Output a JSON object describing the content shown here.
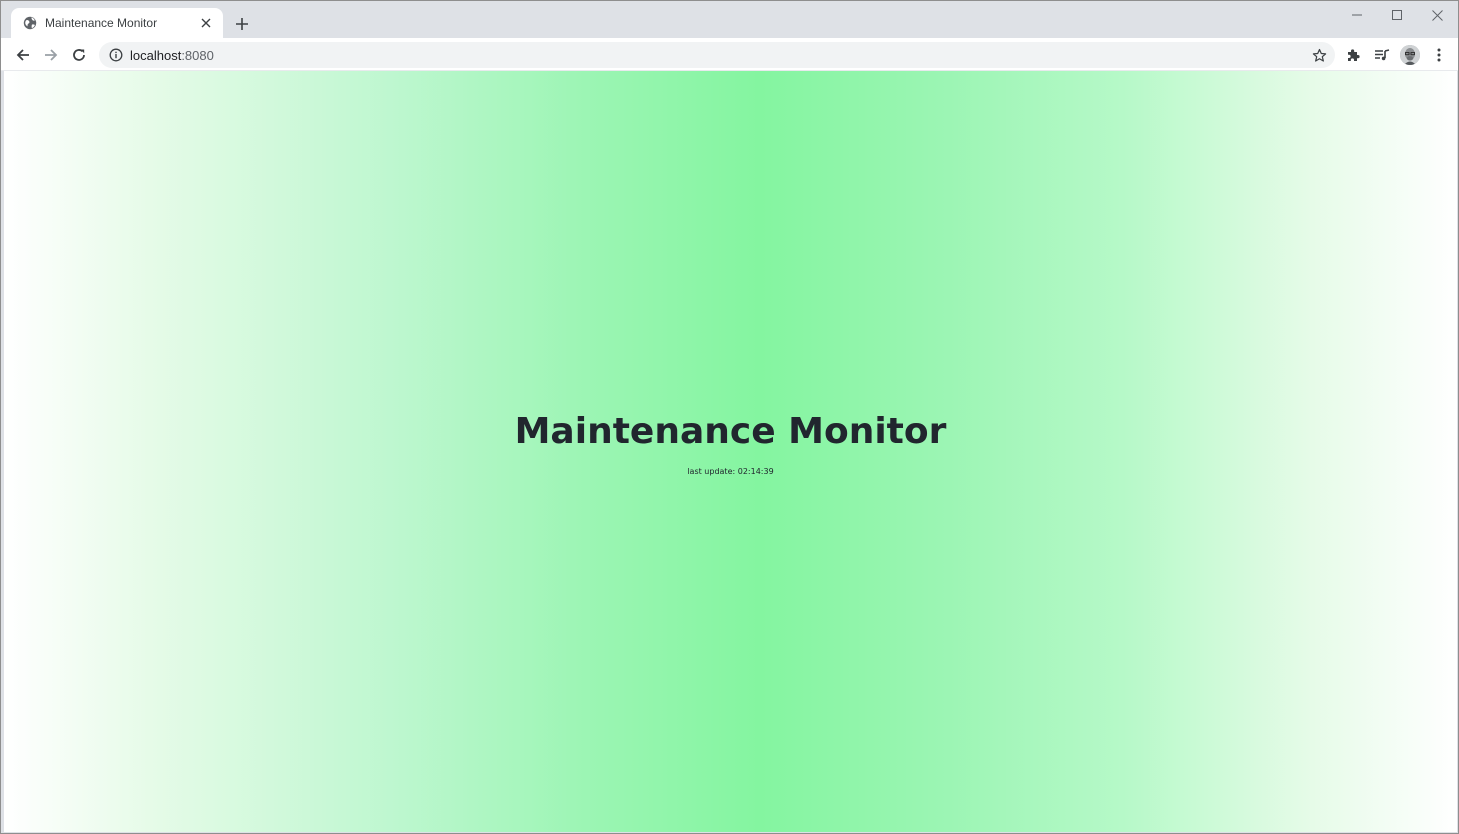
{
  "browser": {
    "tab": {
      "title": "Maintenance Monitor",
      "favicon": "globe-icon"
    },
    "address_bar": {
      "host": "localhost",
      "port": ":8080"
    },
    "icons": {
      "back": "arrow-left-icon",
      "forward": "arrow-right-icon",
      "reload": "reload-icon",
      "info": "info-icon",
      "bookmark": "star-icon",
      "extensions": "puzzle-icon",
      "media": "media-queue-icon",
      "profile": "avatar",
      "menu": "kebab-menu-icon"
    }
  },
  "page": {
    "title": "Maintenance Monitor",
    "last_update": "last update: 02:14:39",
    "colors": {
      "center": "#84f5a0",
      "edge": "#ffffff",
      "text": "#21262e"
    }
  }
}
